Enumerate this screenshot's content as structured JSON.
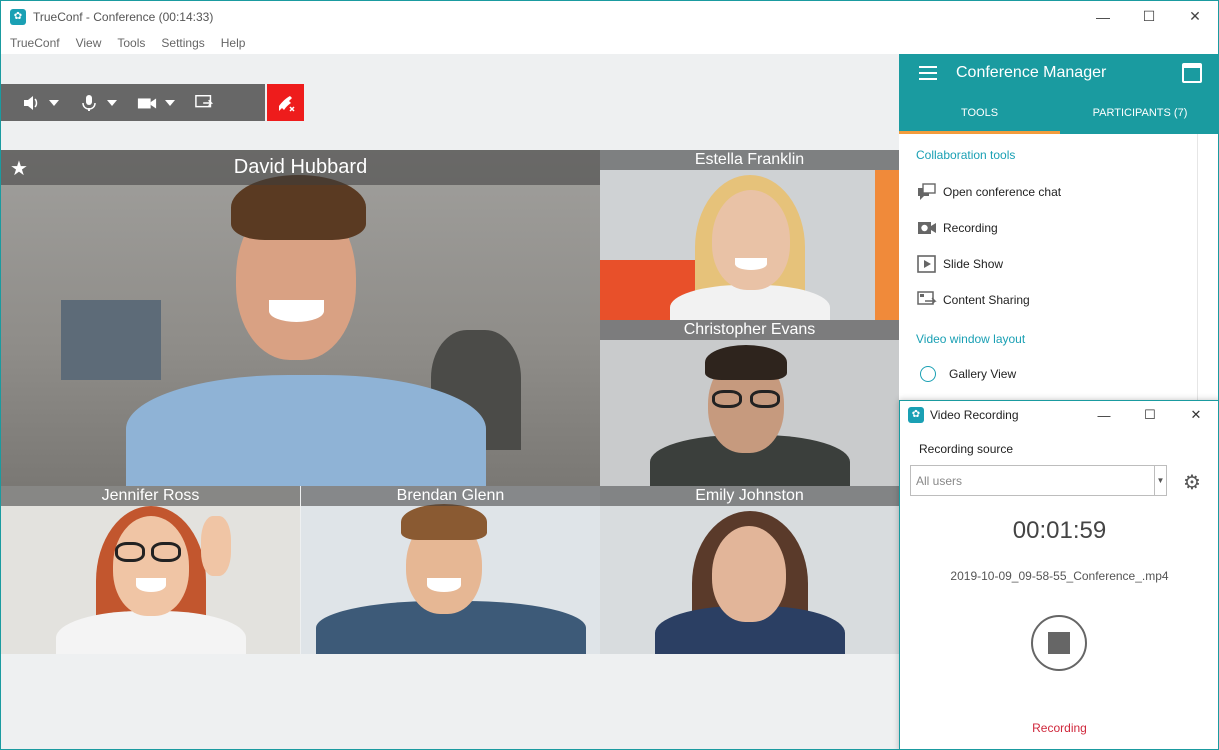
{
  "window": {
    "title": "TrueConf - Conference (00:14:33)",
    "app_icon_glyph": "✿",
    "controls": {
      "minimize": "—",
      "maximize": "☐",
      "close": "✕"
    }
  },
  "menu": [
    "TrueConf",
    "View",
    "Tools",
    "Settings",
    "Help"
  ],
  "toolbar": {
    "icons": [
      "speaker-icon",
      "microphone-icon",
      "camera-icon",
      "screen-share-icon",
      "hangup-icon"
    ]
  },
  "tiles": [
    {
      "name": "David Hubbard",
      "starred": true,
      "bg": "#9a9a98",
      "skin": "#d9a183",
      "hair": "#5a3a22",
      "shirt": "#8fb3d6"
    },
    {
      "name": "Estella Franklin",
      "bg": "#cfd2d4",
      "skin": "#e9c2a6",
      "hair": "#e6c27a",
      "shirt": "#f2f2f2"
    },
    {
      "name": "Christopher Evans",
      "bg": "#c9cbcc",
      "skin": "#c69a7e",
      "hair": "#2e241d",
      "shirt": "#3b3f3c"
    },
    {
      "name": "Jennifer Ross",
      "bg": "#e3e2de",
      "skin": "#f0c5a5",
      "hair": "#c2562e",
      "shirt": "#f4f4f4"
    },
    {
      "name": "Brendan Glenn",
      "bg": "#dfe4e8",
      "skin": "#e6b794",
      "hair": "#8a5a32",
      "shirt": "#3d5a78"
    },
    {
      "name": "Emily Johnston",
      "bg": "#d8dcde",
      "skin": "#e2b599",
      "hair": "#5a3a2a",
      "shirt": "#2b3f63"
    }
  ],
  "panel": {
    "title": "Conference Manager",
    "tabs": [
      {
        "label": "TOOLS",
        "active": true
      },
      {
        "label": "PARTICIPANTS (7)",
        "active": false
      }
    ],
    "sections": {
      "collaboration": "Collaboration tools",
      "layout": "Video window layout"
    },
    "tools": [
      "Open conference chat",
      "Recording",
      "Slide Show",
      "Content Sharing"
    ],
    "layouts": [
      "Gallery View"
    ]
  },
  "recording_dialog": {
    "title": "Video Recording",
    "source_label": "Recording source",
    "source_value": "All users",
    "timer": "00:01:59",
    "filename": "2019-10-09_09-58-55_Conference_.mp4",
    "status": "Recording"
  },
  "colors": {
    "accent": "#1a9ba0",
    "tab_underline": "#f39c3c",
    "hangup": "#ee1c1c",
    "recording": "#d0283c"
  }
}
